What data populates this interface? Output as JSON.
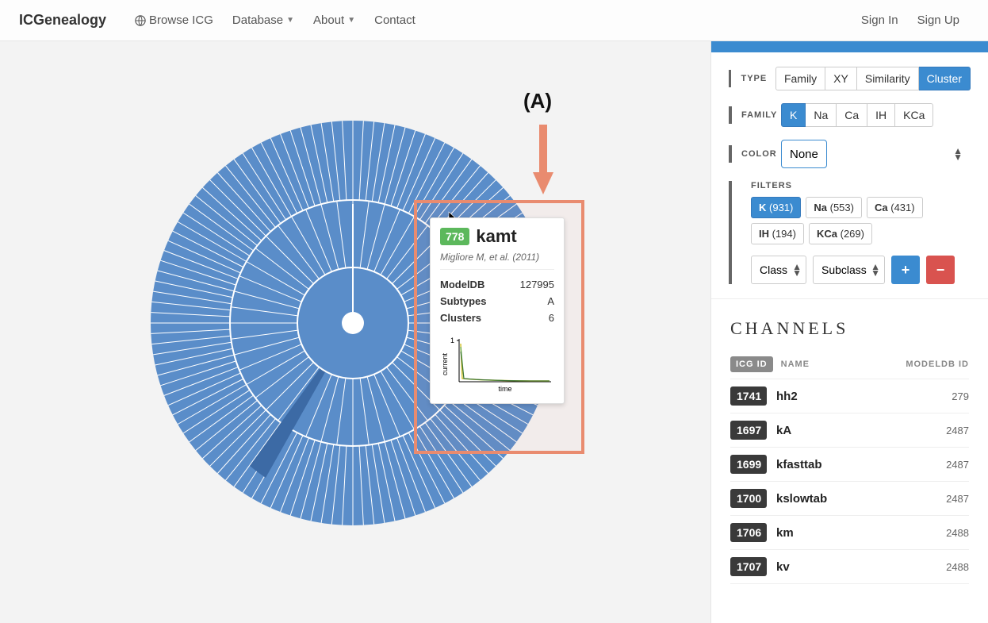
{
  "nav": {
    "brand": "ICGenealogy",
    "browse": "Browse ICG",
    "database": "Database",
    "about": "About",
    "contact": "Contact",
    "signin": "Sign In",
    "signup": "Sign Up"
  },
  "annotation": {
    "label_a": "(A)"
  },
  "tooltip": {
    "id": "778",
    "title": "kamt",
    "citation": "Migliore M, et al. (2011)",
    "rows": {
      "modeldb_label": "ModelDB",
      "modeldb": "127995",
      "subtypes_label": "Subtypes",
      "subtypes": "A",
      "clusters_label": "Clusters",
      "clusters": "6"
    },
    "chart": {
      "ylabel": "current",
      "xlabel": "time",
      "ytick": "1"
    }
  },
  "controls": {
    "type_label": "TYPE",
    "type_options": [
      "Family",
      "XY",
      "Similarity",
      "Cluster"
    ],
    "type_active": "Cluster",
    "family_label": "FAMILY",
    "family_options": [
      "K",
      "Na",
      "Ca",
      "IH",
      "KCa"
    ],
    "family_active": "K",
    "color_label": "COLOR",
    "color_value": "None",
    "filters_label": "FILTERS",
    "filters": [
      {
        "name": "K",
        "count": 931,
        "active": true
      },
      {
        "name": "Na",
        "count": 553,
        "active": false
      },
      {
        "name": "Ca",
        "count": 431,
        "active": false
      },
      {
        "name": "IH",
        "count": 194,
        "active": false
      },
      {
        "name": "KCa",
        "count": 269,
        "active": false
      }
    ],
    "class_label": "Class",
    "subclass_label": "Subclass"
  },
  "channels": {
    "title": "CHANNELS",
    "head": {
      "icg": "ICG ID",
      "name": "NAME",
      "mdb": "MODELDB ID"
    },
    "rows": [
      {
        "id": "1741",
        "name": "hh2",
        "mdb": "279"
      },
      {
        "id": "1697",
        "name": "kA",
        "mdb": "2487"
      },
      {
        "id": "1699",
        "name": "kfasttab",
        "mdb": "2487"
      },
      {
        "id": "1700",
        "name": "kslowtab",
        "mdb": "2487"
      },
      {
        "id": "1706",
        "name": "km",
        "mdb": "2488"
      },
      {
        "id": "1707",
        "name": "kv",
        "mdb": "2488"
      }
    ]
  }
}
